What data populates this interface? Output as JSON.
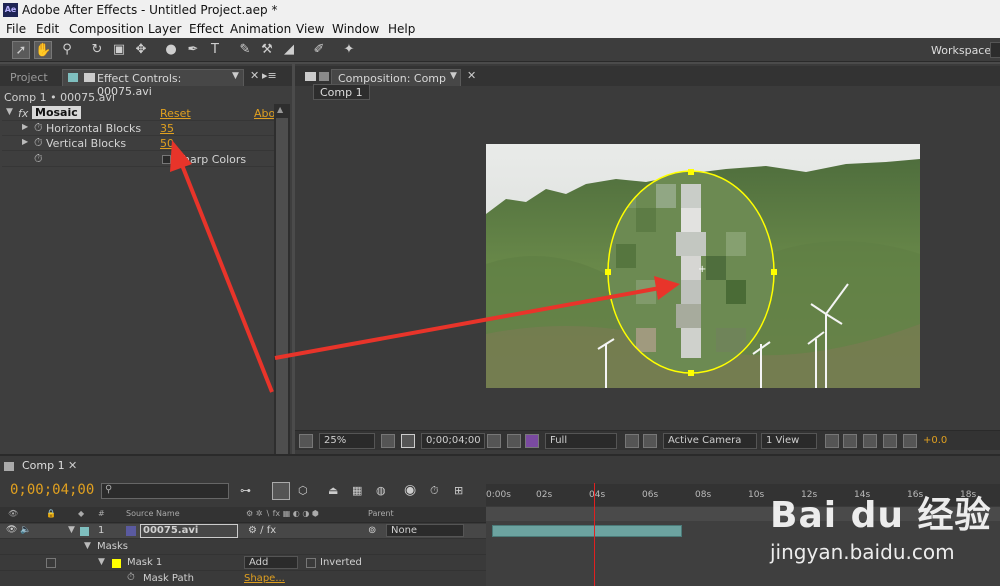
{
  "app": {
    "icon_text": "Ae",
    "title": "Adobe After Effects - Untitled Project.aep *"
  },
  "menu": [
    "File",
    "Edit",
    "Composition",
    "Layer",
    "Effect",
    "Animation",
    "View",
    "Window",
    "Help"
  ],
  "toolbar": {
    "tools": [
      "selection-tool-icon",
      "hand-tool-icon",
      "zoom-tool-icon",
      "rotate-tool-icon",
      "camera-tool-icon",
      "pan-behind-tool-icon",
      "mask-tool-icon",
      "pen-tool-icon",
      "type-tool-icon",
      "brush-tool-icon",
      "clone-stamp-tool-icon",
      "eraser-tool-icon",
      "roto-brush-tool-icon",
      "puppet-pin-tool-icon"
    ],
    "workspace_label": "Workspace:"
  },
  "left_panel": {
    "tab_project": "Project",
    "tab_effect_controls": "Effect Controls: 00075.avi",
    "header": "Comp 1 • 00075.avi",
    "effect": {
      "fx": "fx",
      "name": "Mosaic",
      "reset": "Reset",
      "about": "Abo"
    },
    "properties": [
      {
        "name": "Horizontal Blocks",
        "value": "35"
      },
      {
        "name": "Vertical Blocks",
        "value": "50"
      },
      {
        "name": "Sharp Colors",
        "value": ""
      }
    ]
  },
  "comp_panel": {
    "tab_label": "Composition: Comp 1",
    "sub_tab": "Comp 1",
    "footer": {
      "zoom": "25%",
      "timecode": "0;00;04;00",
      "resolution": "Full",
      "camera": "Active Camera",
      "views": "1 View",
      "exposure": "+0.0"
    }
  },
  "timeline": {
    "tab_label": "Comp 1",
    "timecode": "0;00;04;00",
    "ruler_ticks": [
      "0:00s",
      "02s",
      "04s",
      "06s",
      "08s",
      "10s",
      "12s",
      "14s",
      "16s",
      "18s"
    ],
    "column_source_name": "Source Name",
    "column_parent": "Parent",
    "layer": {
      "number": "1",
      "name": "00075.avi",
      "parent": "None"
    },
    "masks_label": "Masks",
    "mask": {
      "name": "Mask 1",
      "mode": "Add",
      "inverted_label": "Inverted",
      "path_label": "Mask Path",
      "path_value": "Shape..."
    },
    "playhead_fraction": 0.21
  },
  "colors": {
    "accent_value": "#e0a020",
    "arrow": "#e8342a",
    "mask_outline": "#ffff00",
    "layer_bar": "#6ca3a0",
    "playhead": "#e02020"
  },
  "watermark": {
    "logo": "Bai du 经验",
    "url": "jingyan.baidu.com"
  }
}
